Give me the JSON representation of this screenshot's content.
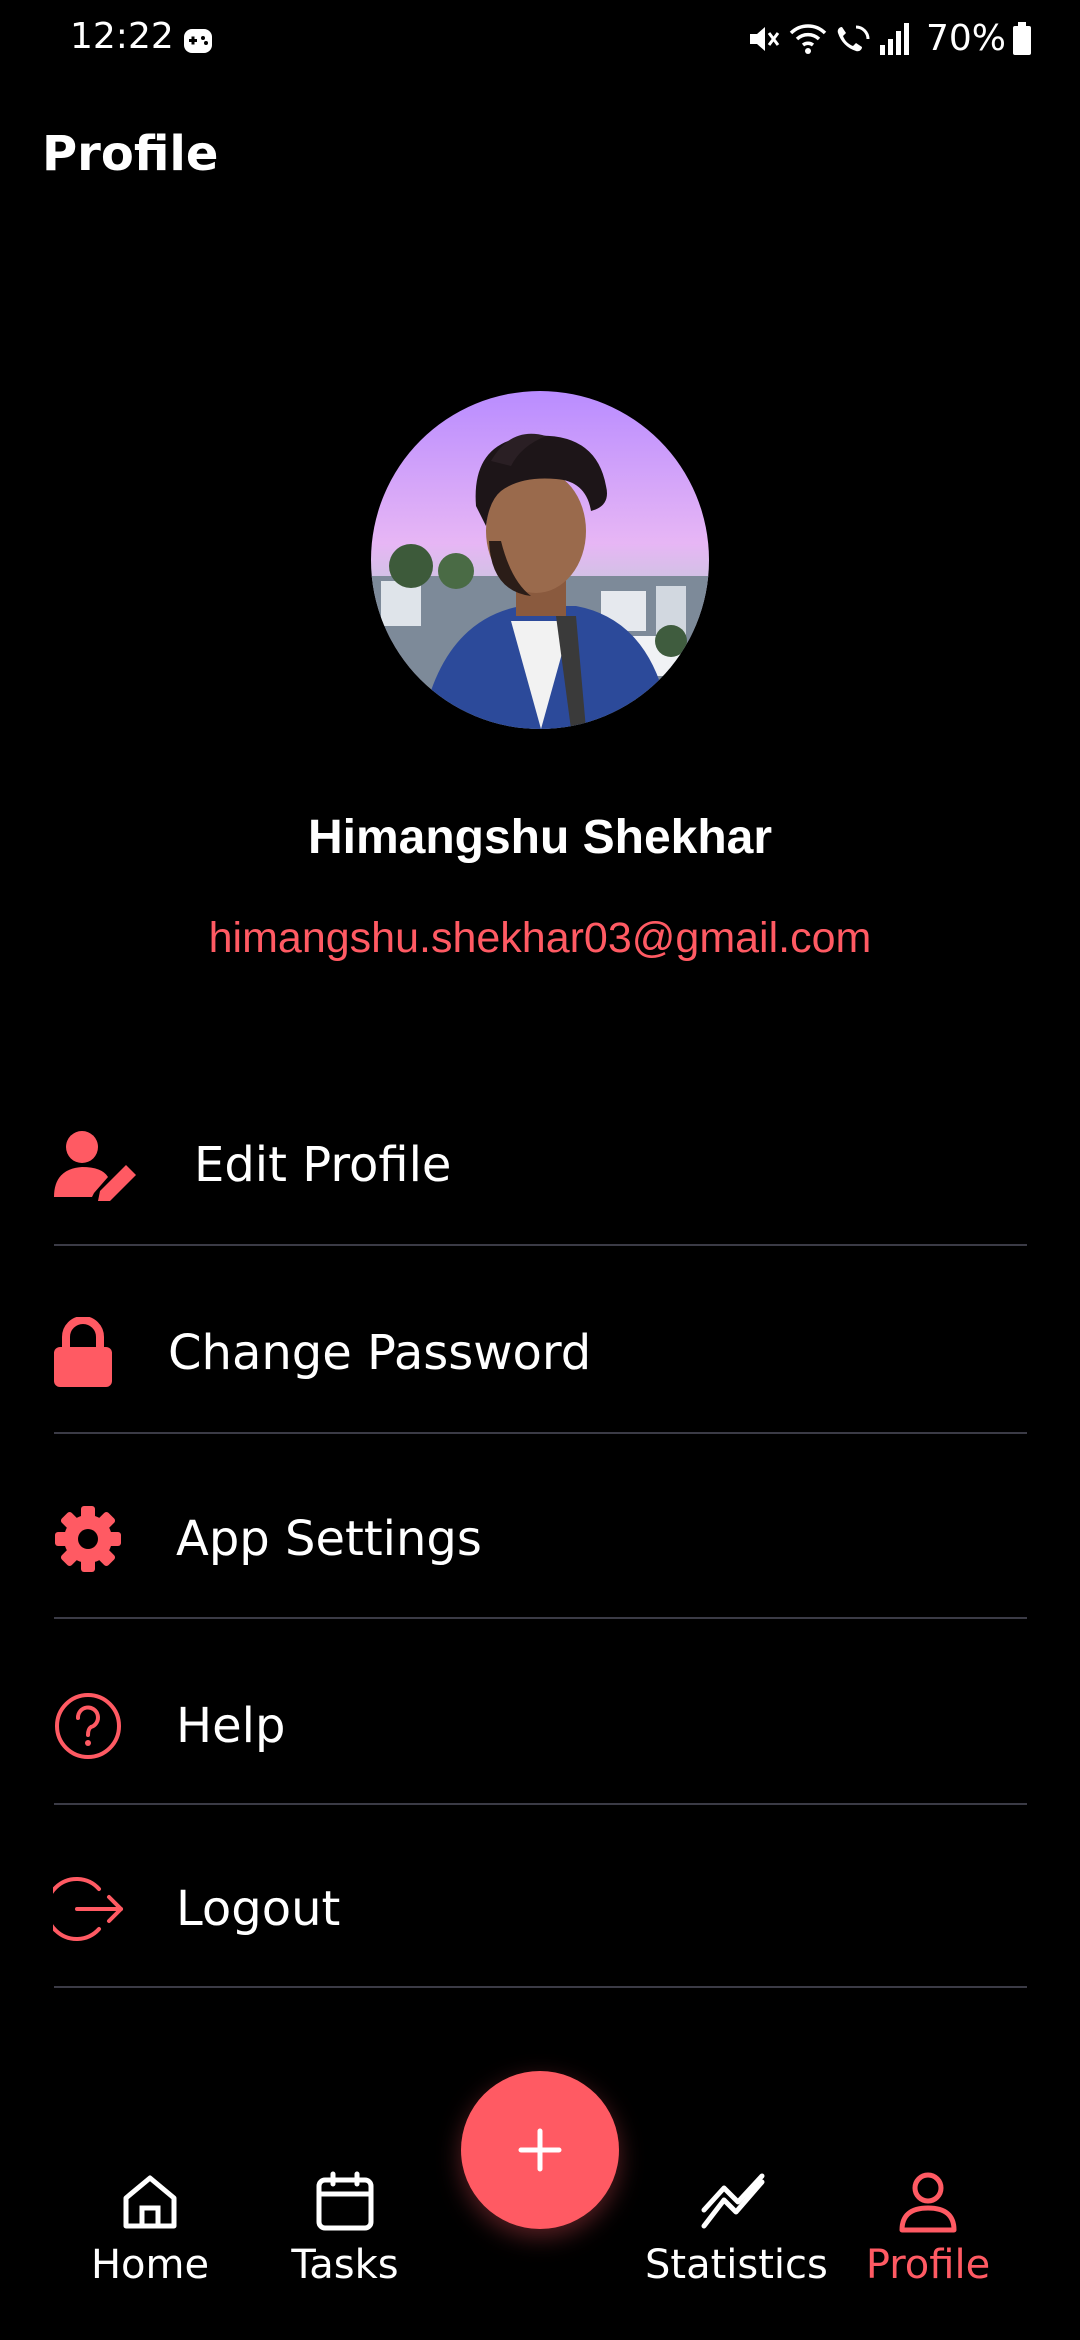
{
  "status_bar": {
    "time": "12:22",
    "battery": "70%"
  },
  "page": {
    "title": "Profile"
  },
  "profile": {
    "name": "Himangshu Shekhar",
    "email": "himangshu.shekhar03@gmail.com"
  },
  "menu": [
    {
      "label": "Edit Profile",
      "icon": "user-edit-icon"
    },
    {
      "label": "Change Password",
      "icon": "lock-icon"
    },
    {
      "label": "App Settings",
      "icon": "gear-icon"
    },
    {
      "label": "Help",
      "icon": "help-icon"
    },
    {
      "label": "Logout",
      "icon": "logout-icon"
    }
  ],
  "nav": {
    "home": "Home",
    "tasks": "Tasks",
    "statistics": "Statistics",
    "profile": "Profile"
  },
  "colors": {
    "accent": "#ff5a63",
    "background": "#000000",
    "divider": "#3b3b46"
  }
}
